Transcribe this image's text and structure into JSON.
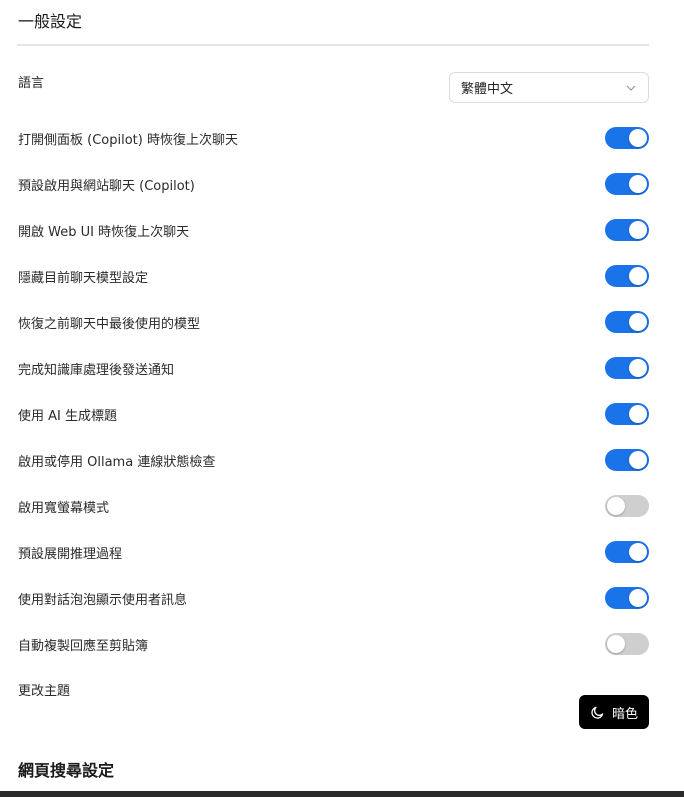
{
  "general": {
    "title": "一般設定",
    "language_label": "語言",
    "language_value": "繁體中文"
  },
  "toggles": [
    {
      "label": "打開側面板 (Copilot) 時恢復上次聊天",
      "on": true
    },
    {
      "label": "預設啟用與網站聊天 (Copilot)",
      "on": true
    },
    {
      "label": "開啟 Web UI 時恢復上次聊天",
      "on": true
    },
    {
      "label": "隱藏目前聊天模型設定",
      "on": true
    },
    {
      "label": "恢復之前聊天中最後使用的模型",
      "on": true
    },
    {
      "label": "完成知識庫處理後發送通知",
      "on": true
    },
    {
      "label": "使用 AI 生成標題",
      "on": true
    },
    {
      "label": "啟用或停用 Ollama 連線狀態檢查",
      "on": true
    },
    {
      "label": "啟用寬螢幕模式",
      "on": false
    },
    {
      "label": "預設展開推理過程",
      "on": true
    },
    {
      "label": "使用對話泡泡顯示使用者訊息",
      "on": true
    },
    {
      "label": "自動複製回應至剪貼簿",
      "on": false
    }
  ],
  "theme": {
    "label": "更改主題",
    "button_label": "暗色",
    "icon": "moon-icon"
  },
  "web_search": {
    "title": "網頁搜尋設定"
  },
  "colors": {
    "accent": "#1a73e8",
    "toggle_off": "#cfcfcf",
    "theme_button": "#000000"
  }
}
